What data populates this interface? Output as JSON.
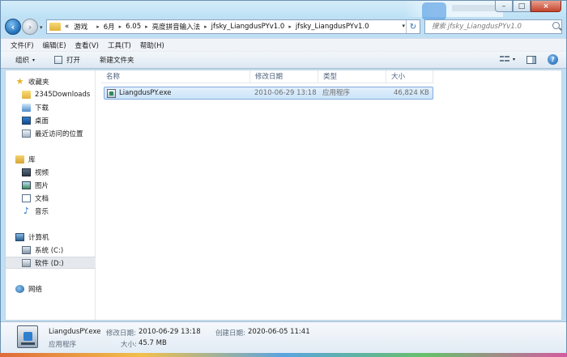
{
  "navigation": {
    "back_label": "‹",
    "forward_label": "›",
    "recent_caret": "▾",
    "breadcrumbs": [
      "«",
      "游戏",
      "6月",
      "6.05",
      "亮度拼音输入法",
      "jfsky_LiangdusPYv1.0",
      "jfsky_LiangdusPYv1.0"
    ],
    "address_dropdown": "▾",
    "refresh_label": "↻"
  },
  "search": {
    "placeholder": "搜索 jfsky_LiangdusPYv1.0"
  },
  "window_controls": {
    "minimize": "–",
    "maximize": "□",
    "close": "×"
  },
  "menu": [
    "文件(F)",
    "编辑(E)",
    "查看(V)",
    "工具(T)",
    "帮助(H)"
  ],
  "toolbar": {
    "organize_label": "组织",
    "organize_caret": "▾",
    "open_label": "打开",
    "new_folder_label": "新建文件夹",
    "views_caret": "▾",
    "help_label": "?"
  },
  "sidebar": {
    "favorites": {
      "label": "收藏夹",
      "items": [
        "2345Downloads",
        "下载",
        "桌面",
        "最近访问的位置"
      ]
    },
    "libraries": {
      "label": "库",
      "items": [
        "视频",
        "图片",
        "文档",
        "音乐"
      ]
    },
    "computer": {
      "label": "计算机",
      "items": [
        "系统 (C:)",
        "软件 (D:)"
      ]
    },
    "network": {
      "label": "网络"
    }
  },
  "columns": [
    "名称",
    "修改日期",
    "类型",
    "大小"
  ],
  "files": [
    {
      "name": "LiangdusPY.exe",
      "modified": "2010-06-29 13:18",
      "type": "应用程序",
      "size": "46,824 KB"
    }
  ],
  "details_pane": {
    "filename": "LiangdusPY.exe",
    "modified_label": "修改日期:",
    "modified_value": "2010-06-29 13:18",
    "created_label": "创建日期:",
    "created_value": "2020-06-05 11:41",
    "type_value": "应用程序",
    "size_label": "大小:",
    "size_value": "45.7 MB"
  }
}
